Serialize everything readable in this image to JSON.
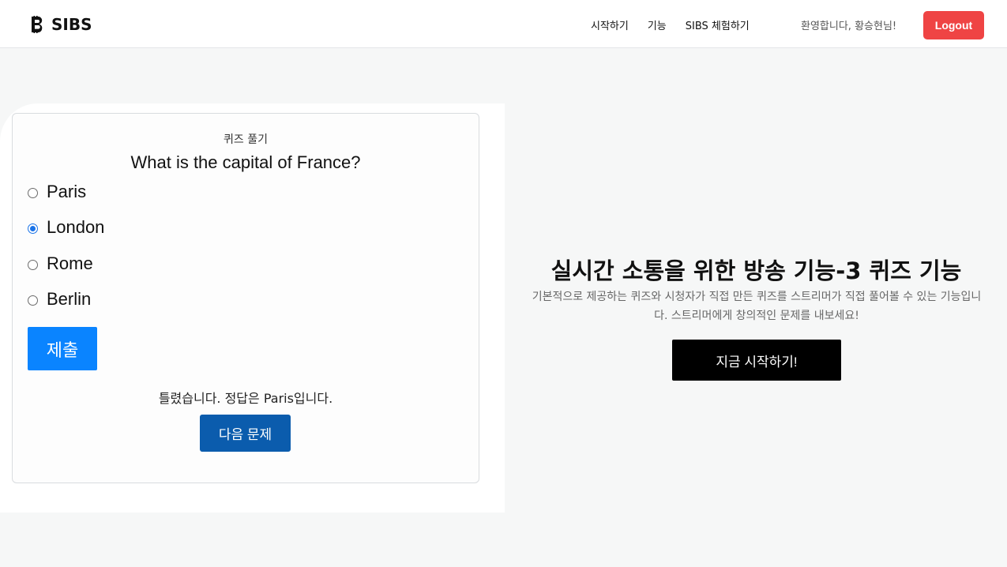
{
  "header": {
    "brand": "SIBS",
    "nav": [
      "시작하기",
      "기능",
      "SIBS 체험하기"
    ],
    "welcome": "환영합니다, 황승현님!",
    "logout_label": "Logout"
  },
  "quiz": {
    "heading": "퀴즈 풀기",
    "question": "What is the capital of France?",
    "options": [
      "Paris",
      "London",
      "Rome",
      "Berlin"
    ],
    "selected": "London",
    "submit_label": "제출",
    "result": "틀렸습니다. 정답은 Paris입니다.",
    "next_label": "다음 문제"
  },
  "feature": {
    "title": "실시간 소통을 위한 방송 기능-3 퀴즈 기능",
    "description": "기본적으로 제공하는 퀴즈와 시청자가 직접 만든 퀴즈를 스트리머가 직접 풀어볼 수 있는 기능입니다. 스트리머에게 창의적인 문제를 내보세요!",
    "cta_label": "지금 시작하기!"
  },
  "colors": {
    "logout": "#ef4444",
    "submit": "#0a84ff",
    "next": "#0b5cad",
    "cta": "#000000",
    "radio_checked": "#1a73e8"
  }
}
